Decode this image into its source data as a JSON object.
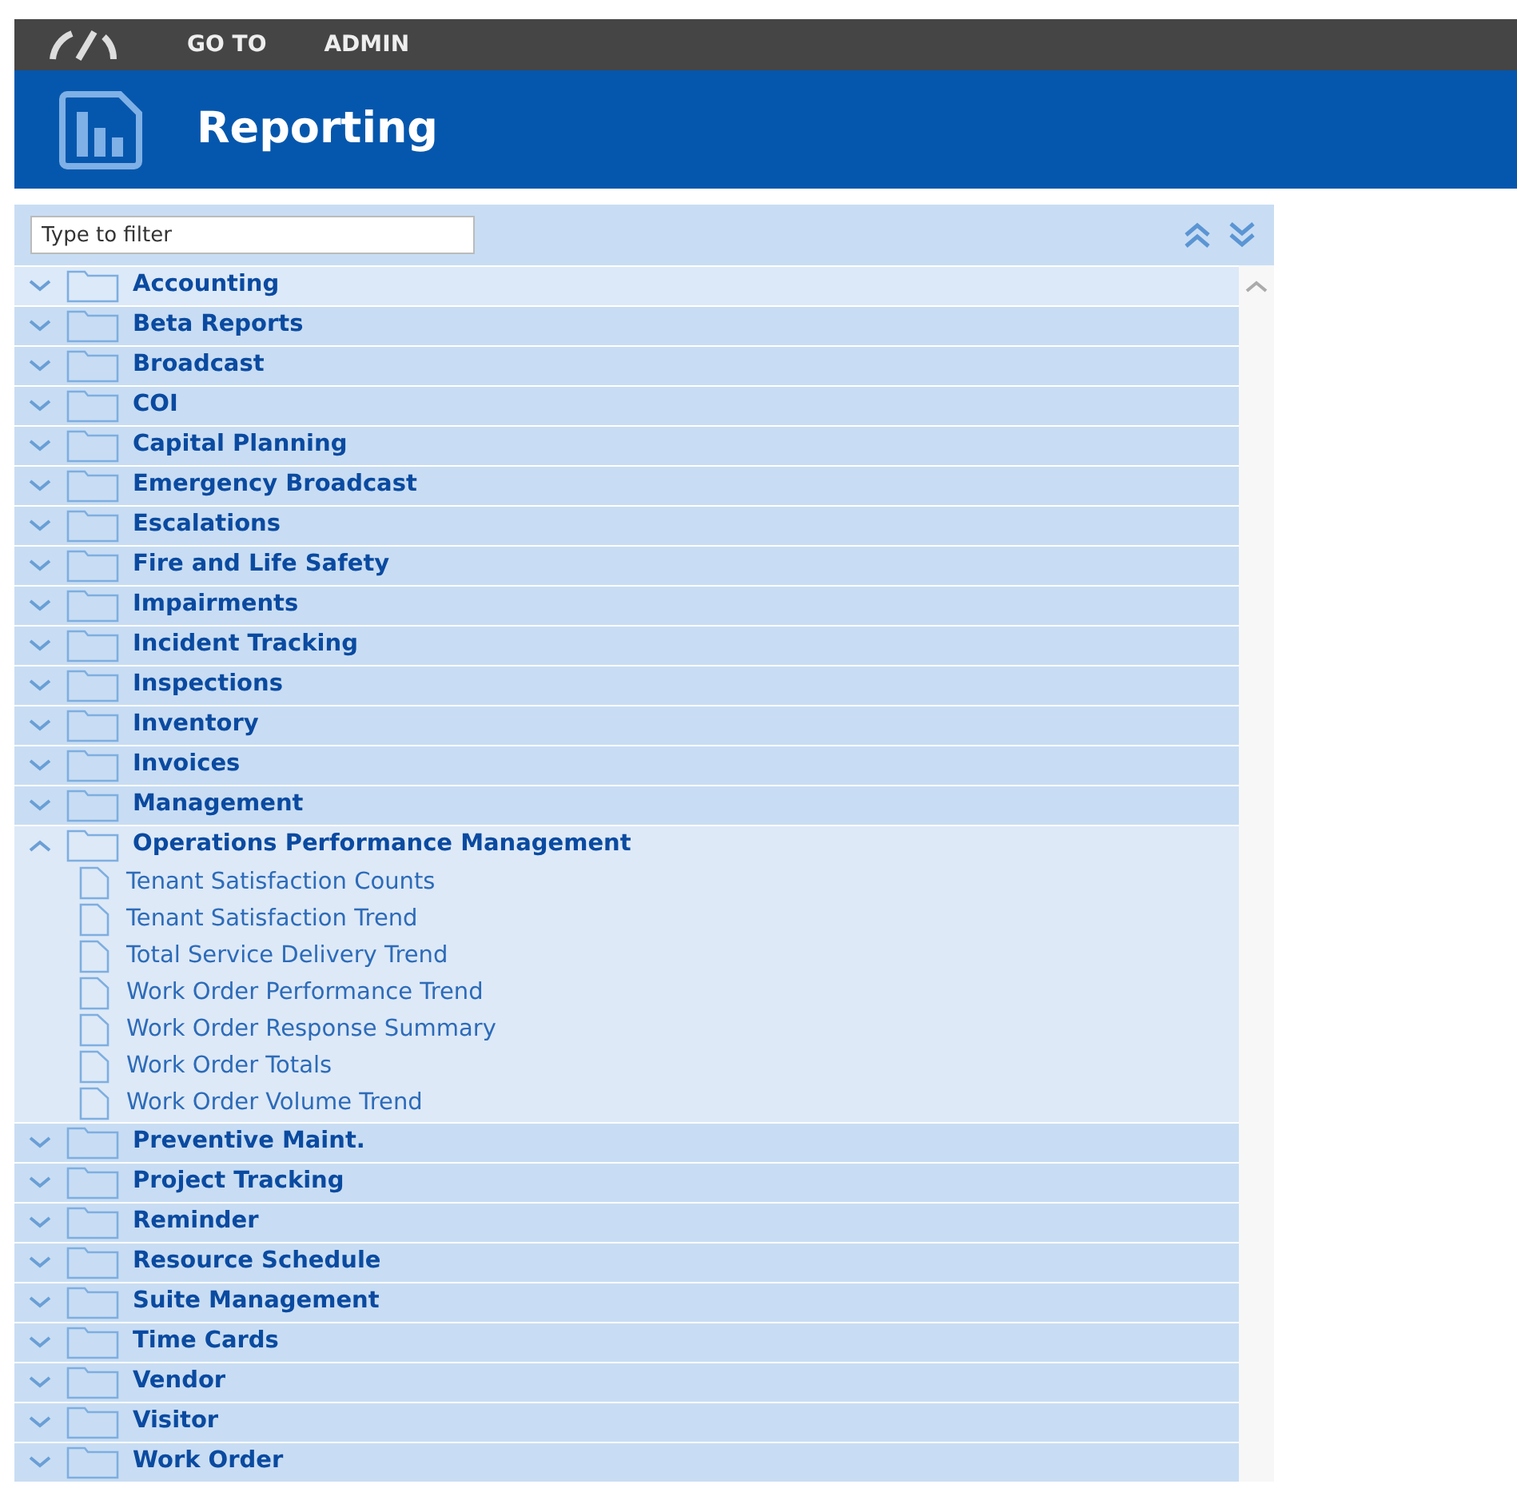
{
  "top_bar": {
    "menu": [
      "GO TO",
      "ADMIN"
    ]
  },
  "header": {
    "title": "Reporting"
  },
  "filter": {
    "placeholder": "Type to filter"
  },
  "folders": [
    {
      "label": "Accounting",
      "expanded": false,
      "highlighted": true
    },
    {
      "label": "Beta Reports",
      "expanded": false,
      "highlighted": false
    },
    {
      "label": "Broadcast",
      "expanded": false,
      "highlighted": false
    },
    {
      "label": "COI",
      "expanded": false,
      "highlighted": false
    },
    {
      "label": "Capital Planning",
      "expanded": false,
      "highlighted": false
    },
    {
      "label": "Emergency Broadcast",
      "expanded": false,
      "highlighted": false
    },
    {
      "label": "Escalations",
      "expanded": false,
      "highlighted": false
    },
    {
      "label": "Fire and Life Safety",
      "expanded": false,
      "highlighted": false
    },
    {
      "label": "Impairments",
      "expanded": false,
      "highlighted": false
    },
    {
      "label": "Incident Tracking",
      "expanded": false,
      "highlighted": false
    },
    {
      "label": "Inspections",
      "expanded": false,
      "highlighted": false
    },
    {
      "label": "Inventory",
      "expanded": false,
      "highlighted": false
    },
    {
      "label": "Invoices",
      "expanded": false,
      "highlighted": false
    },
    {
      "label": "Management",
      "expanded": false,
      "highlighted": false
    },
    {
      "label": "Operations Performance Management",
      "expanded": true,
      "highlighted": false,
      "children": [
        {
          "label": "Tenant Satisfaction Counts"
        },
        {
          "label": "Tenant Satisfaction Trend"
        },
        {
          "label": "Total Service Delivery Trend"
        },
        {
          "label": "Work Order Performance Trend"
        },
        {
          "label": "Work Order Response Summary"
        },
        {
          "label": "Work Order Totals"
        },
        {
          "label": "Work Order Volume Trend"
        }
      ]
    },
    {
      "label": "Preventive Maint.",
      "expanded": false,
      "highlighted": false
    },
    {
      "label": "Project Tracking",
      "expanded": false,
      "highlighted": false
    },
    {
      "label": "Reminder",
      "expanded": false,
      "highlighted": false
    },
    {
      "label": "Resource Schedule",
      "expanded": false,
      "highlighted": false
    },
    {
      "label": "Suite Management",
      "expanded": false,
      "highlighted": false
    },
    {
      "label": "Time Cards",
      "expanded": false,
      "highlighted": false
    },
    {
      "label": "Vendor",
      "expanded": false,
      "highlighted": false
    },
    {
      "label": "Visitor",
      "expanded": false,
      "highlighted": false
    },
    {
      "label": "Work Order",
      "expanded": false,
      "highlighted": false
    }
  ]
}
